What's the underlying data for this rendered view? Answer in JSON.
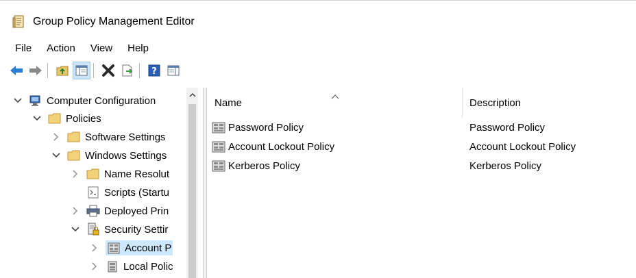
{
  "window": {
    "title": "Group Policy Management Editor"
  },
  "menu": [
    "File",
    "Action",
    "View",
    "Help"
  ],
  "tree": {
    "items": [
      {
        "label": "Computer Configuration",
        "expanded": true,
        "icon": "computer-config-icon"
      },
      {
        "label": "Policies",
        "expanded": true,
        "icon": "folder-icon"
      },
      {
        "label": "Software Settings",
        "expanded": false,
        "icon": "folder-icon"
      },
      {
        "label": "Windows Settings",
        "expanded": true,
        "icon": "folder-icon"
      },
      {
        "label": "Name Resolut",
        "expanded": false,
        "icon": "folder-icon"
      },
      {
        "label": "Scripts (Startu",
        "expanded": null,
        "icon": "script-icon"
      },
      {
        "label": "Deployed Prin",
        "expanded": false,
        "icon": "printer-icon"
      },
      {
        "label": "Security Settir",
        "expanded": true,
        "icon": "security-settings-icon"
      },
      {
        "label": "Account P",
        "expanded": false,
        "icon": "policy-icon",
        "selected": true
      },
      {
        "label": "Local Polic",
        "expanded": false,
        "icon": "policy-icon"
      }
    ]
  },
  "list": {
    "columns": {
      "name": "Name",
      "description": "Description"
    },
    "rows": [
      {
        "name": "Password Policy",
        "description": "Password Policy"
      },
      {
        "name": "Account Lockout Policy",
        "description": "Account Lockout Policy"
      },
      {
        "name": "Kerberos Policy",
        "description": "Kerberos Policy"
      }
    ]
  },
  "colors": {
    "selection": "#cce8ff",
    "folder": "#e8c66a",
    "back_arrow": "#2a7fd4"
  }
}
